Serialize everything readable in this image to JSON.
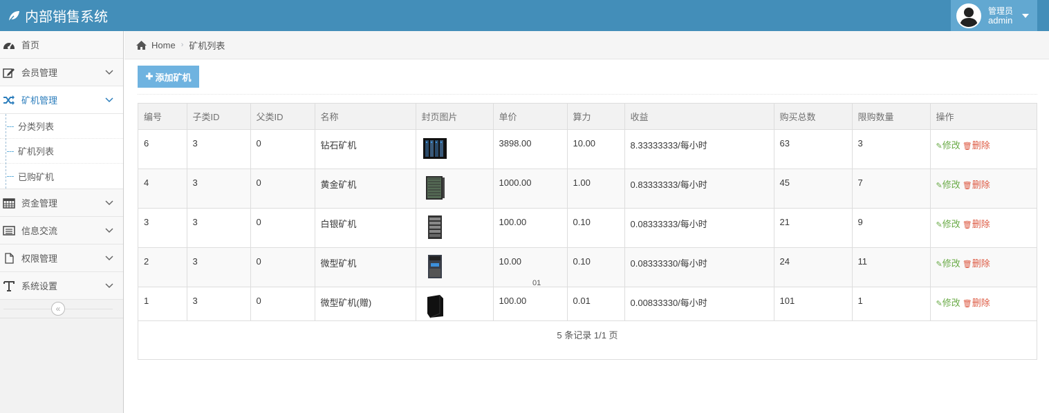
{
  "app": {
    "title": "内部销售系统"
  },
  "user": {
    "role": "管理员",
    "name": "admin"
  },
  "sidebar": {
    "items": [
      {
        "label": "首页"
      },
      {
        "label": "会员管理"
      },
      {
        "label": "矿机管理"
      },
      {
        "label": "资金管理"
      },
      {
        "label": "信息交流"
      },
      {
        "label": "权限管理"
      },
      {
        "label": "系统设置"
      }
    ],
    "sub_items": [
      {
        "label": "分类列表"
      },
      {
        "label": "矿机列表"
      },
      {
        "label": "已购矿机"
      }
    ],
    "collapse_glyph": "«"
  },
  "breadcrumb": {
    "home": "Home",
    "current": "矿机列表"
  },
  "toolbar": {
    "add_label": "添加矿机"
  },
  "table": {
    "headers": [
      "编号",
      "子类ID",
      "父类ID",
      "名称",
      "封页图片",
      "单价",
      "算力",
      "收益",
      "购买总数",
      "限购数量",
      "操作"
    ],
    "rows": [
      {
        "id": "6",
        "sub_id": "3",
        "parent_id": "0",
        "name": "钻石矿机",
        "price": "3898.00",
        "power": "10.00",
        "income": "8.33333333/每小时",
        "total": "63",
        "limit": "3"
      },
      {
        "id": "4",
        "sub_id": "3",
        "parent_id": "0",
        "name": "黄金矿机",
        "price": "1000.00",
        "power": "1.00",
        "income": "0.83333333/每小时",
        "total": "45",
        "limit": "7"
      },
      {
        "id": "3",
        "sub_id": "3",
        "parent_id": "0",
        "name": "白银矿机",
        "price": "100.00",
        "power": "0.10",
        "income": "0.08333333/每小时",
        "total": "21",
        "limit": "9"
      },
      {
        "id": "2",
        "sub_id": "3",
        "parent_id": "0",
        "name": "微型矿机",
        "price": "10.00",
        "power": "0.10",
        "income": "0.08333330/每小时",
        "total": "24",
        "limit": "11"
      },
      {
        "id": "1",
        "sub_id": "3",
        "parent_id": "0",
        "name": "微型矿机(赠)",
        "price": "100.00",
        "power": "0.01",
        "income": "0.00833330/每小时",
        "total": "101",
        "limit": "1"
      }
    ],
    "edit_label": "修改",
    "delete_label": "删除",
    "footer": "5 条记录 1/1 页",
    "stray_text": "01"
  }
}
